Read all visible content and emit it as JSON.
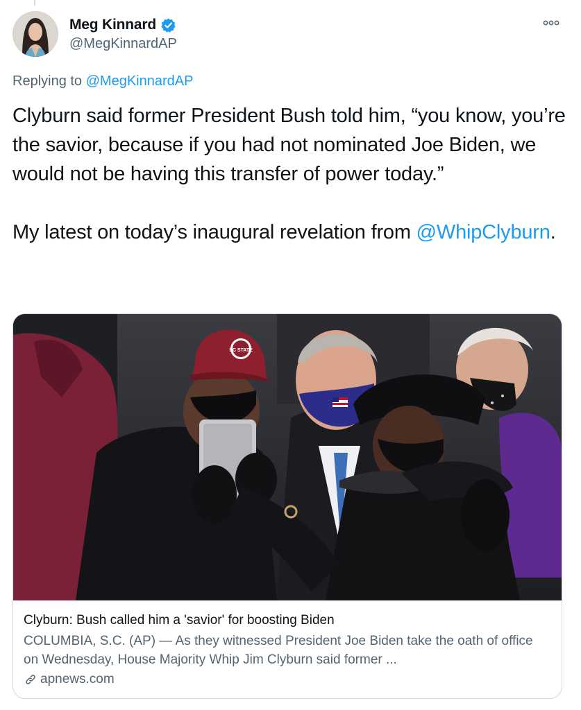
{
  "tweet": {
    "author": {
      "display_name": "Meg Kinnard",
      "handle": "@MegKinnardAP",
      "verified": true,
      "avatar_icon": "profile-photo"
    },
    "reply_context": {
      "prefix": "Replying to",
      "mention": "@MegKinnardAP"
    },
    "text": {
      "paragraph_1": "Clyburn said former President Bush told him, “you know, you’re the savior, because if you had not nominated Joe Biden, we would not be having this transfer of power today.”",
      "paragraph_2_prefix": "My latest on today’s inaugural revelation from",
      "paragraph_2_mention": "@WhipClyburn",
      "paragraph_2_suffix": "."
    },
    "menu_icon": "more-horizontal-icon"
  },
  "link_card": {
    "image_alt": "photo",
    "cap_text": "SC STATE",
    "title": "Clyburn: Bush called him a 'savior' for boosting Biden",
    "description": "COLUMBIA, S.C. (AP) — As they witnessed President Joe Biden take the oath of office on Wednesday, House Majority Whip Jim Clyburn said former ...",
    "domain": "apnews.com",
    "domain_icon": "link-icon"
  },
  "colors": {
    "accent": "#1d9bf0",
    "text_primary": "#0f1419",
    "text_secondary": "#536471",
    "border": "#cfd9de"
  }
}
